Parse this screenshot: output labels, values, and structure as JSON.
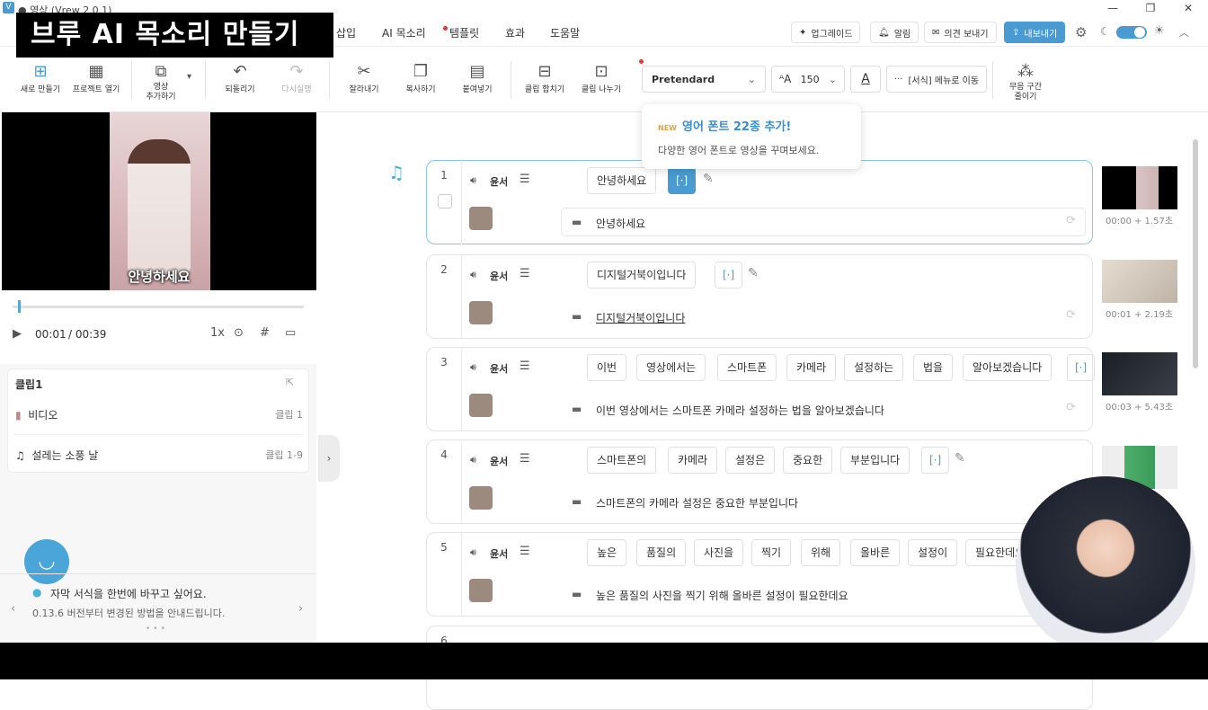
{
  "window": {
    "title": "● 영상 (Vrew 2.0.1)",
    "logo": "V",
    "min": "—",
    "max": "❐",
    "close": "✕"
  },
  "banner": {
    "text": "브루 AI 목소리 만들기"
  },
  "menu": {
    "items": [
      "삽입",
      "AI 목소리",
      "템플릿",
      "효과",
      "도움말"
    ],
    "upgrade": "업그레이드",
    "alarm": "알림",
    "feedback": "의견 보내기",
    "export": "내보내기"
  },
  "toolbar": {
    "new_project": "새로 만들기",
    "open_project": "프로젝트 열기",
    "add_video": "영상\n추가하기",
    "undo": "되돌리기",
    "redo": "다시실행",
    "cut": "잘라내기",
    "copy": "복사하기",
    "paste": "붙여넣기",
    "merge_clip": "클립 합치기",
    "split_clip": "클립 나누기",
    "font": "Pretendard",
    "font_size": "150",
    "format_menu": "[서식] 메뉴로 이동",
    "silence": "무음 구간\n줄이기"
  },
  "tooltip": {
    "badge": "NEW",
    "title": "영어 폰트 22종 추가!",
    "body": "다양한 영어 폰트로 영상을 꾸며보세요."
  },
  "player": {
    "subtitle": "안녕하세요",
    "current_time": "00:01",
    "total_time": "/ 00:39",
    "speed": "1x"
  },
  "clip_panel": {
    "title": "클립1",
    "video_label": "비디오",
    "video_value": "클립 1",
    "music_label": "설레는 소풍 날",
    "music_value": "클립 1-9"
  },
  "tips": {
    "line1": "자막 서식을 한번에 바꾸고 싶어요.",
    "line2": "0.13.6 버전부터 변경된 방법을 안내드립니다."
  },
  "rows": [
    {
      "num": "1",
      "speaker": "윤서",
      "words": [
        "안녕하세요"
      ],
      "subtitle": "안녕하세요",
      "time": "00:00 + 1.57초"
    },
    {
      "num": "2",
      "speaker": "윤서",
      "words": [
        "디지털거북이입니다"
      ],
      "subtitle": "디지털거북이입니다",
      "time": "00:01 + 2.19초"
    },
    {
      "num": "3",
      "speaker": "윤서",
      "words": [
        "이번",
        "영상에서는",
        "스마트폰",
        "카메라",
        "설정하는",
        "법을",
        "알아보겠습니다"
      ],
      "subtitle": "이번 영상에서는 스마트폰 카메라 설정하는 법을 알아보겠습니다",
      "time": "00:03 + 5.43초"
    },
    {
      "num": "4",
      "speaker": "윤서",
      "words": [
        "스마트폰의",
        "카메라",
        "설정은",
        "중요한",
        "부분입니다"
      ],
      "subtitle": "스마트폰의 카메라 설정은 중요한 부분입니다",
      "time": ""
    },
    {
      "num": "5",
      "speaker": "윤서",
      "words": [
        "높은",
        "품질의",
        "사진을",
        "찍기",
        "위해",
        "올바른",
        "설정이",
        "필요한데요"
      ],
      "subtitle": "높은 품질의 사진을 찍기 위해 올바른 설정이 필요한데요",
      "time": ""
    },
    {
      "num": "6",
      "speaker": "",
      "words": [],
      "subtitle": "",
      "time": ""
    }
  ],
  "bracket": "[·]"
}
